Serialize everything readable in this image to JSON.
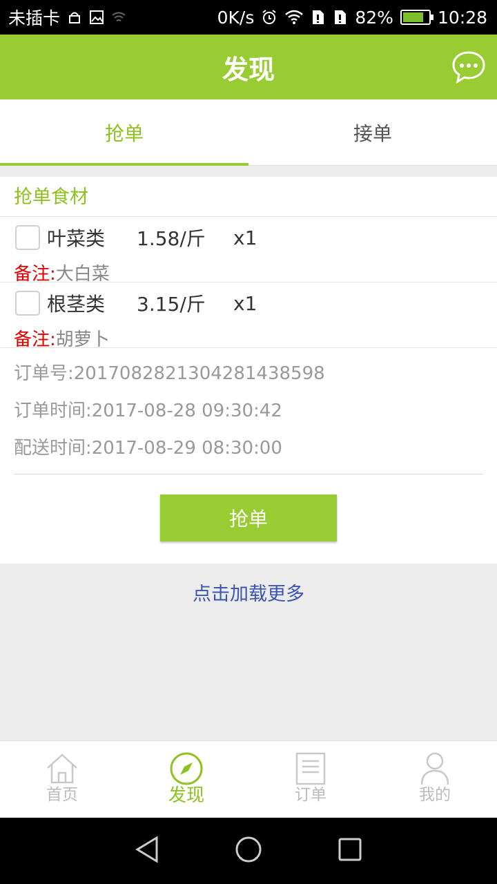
{
  "status": {
    "carrier": "未插卡",
    "speed": "0K/s",
    "battery": "82%",
    "time": "10:28",
    "battery_level": 0.82
  },
  "header": {
    "title": "发现"
  },
  "tabs": [
    {
      "label": "抢单",
      "active": true
    },
    {
      "label": "接单",
      "active": false
    }
  ],
  "order": {
    "section_title": "抢单食材",
    "items": [
      {
        "name": "叶菜类",
        "price": "1.58/斤",
        "qty": "x1",
        "note_label": "备注:",
        "note": "大白菜"
      },
      {
        "name": "根茎类",
        "price": "3.15/斤",
        "qty": "x1",
        "note_label": "备注:",
        "note": "胡萝卜"
      }
    ],
    "order_no": "订单号:20170828213042814385 98",
    "order_no_text": "订单号:201708282130428143859 8",
    "order_number": "订单号:2017082821304281438598",
    "order_time": "订单时间:2017-08-28 09:30:42",
    "delivery_time": "配送时间:2017-08-29 08:30:00",
    "grab_button": "抢单"
  },
  "load_more": "点击加载更多",
  "bottom_nav": [
    {
      "label": "首页",
      "icon": "home-icon"
    },
    {
      "label": "发现",
      "icon": "compass-icon"
    },
    {
      "label": "订单",
      "icon": "order-list-icon"
    },
    {
      "label": "我的",
      "icon": "profile-icon"
    }
  ],
  "colors": {
    "accent": "#99cc33",
    "accent_text": "#8dc21f",
    "note_red": "#e00000",
    "link_blue": "#3b55b5"
  }
}
